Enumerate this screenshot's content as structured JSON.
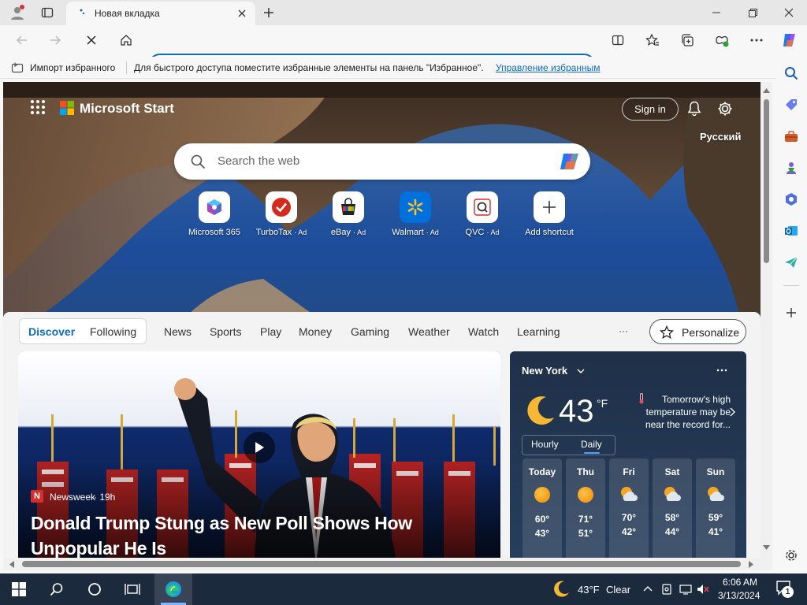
{
  "browser": {
    "tab_title": "Новая вкладка",
    "address_value": "",
    "favorites_bar": {
      "import_label": "Импорт избранного",
      "hint_text": "Для быстрого доступа поместите избранные элементы на панель \"Избранное\".",
      "manage_link": "Управление избранным"
    }
  },
  "start_page": {
    "brand": "Microsoft Start",
    "sign_in_label": "Sign in",
    "language": "Русский",
    "search_placeholder": "Search the web",
    "shortcuts": [
      {
        "label": "Microsoft 365",
        "ad": "",
        "icon": "microsoft-365-icon"
      },
      {
        "label": "TurboTax",
        "ad": "· Ad",
        "icon": "turbotax-icon"
      },
      {
        "label": "eBay",
        "ad": "· Ad",
        "icon": "ebay-icon"
      },
      {
        "label": "Walmart",
        "ad": "· Ad",
        "icon": "walmart-icon"
      },
      {
        "label": "QVC",
        "ad": "· Ad",
        "icon": "qvc-icon"
      },
      {
        "label": "Add shortcut",
        "ad": "",
        "icon": "plus-icon"
      }
    ],
    "nav_tabs": [
      "Discover",
      "Following",
      "News",
      "Sports",
      "Play",
      "Money",
      "Gaming",
      "Weather",
      "Watch",
      "Learning"
    ],
    "nav_more": "···",
    "personalize_label": "Personalize",
    "story": {
      "source": "Newsweek",
      "age": "· 19h",
      "headline_line1": "Donald Trump Stung as New Poll Shows How",
      "headline_line2": "Unpopular He Is"
    },
    "weather": {
      "city": "New York",
      "temp": "43",
      "unit": "°F",
      "alert_line1": "Tomorrow's high",
      "alert_line2": "temperature may be",
      "alert_line3": "near the record for...",
      "toggle": [
        "Hourly",
        "Daily"
      ],
      "days": [
        {
          "name": "Today",
          "high": "60°",
          "low": "43°",
          "icon": "sunny-icon"
        },
        {
          "name": "Thu",
          "high": "71°",
          "low": "51°",
          "icon": "sunny-icon"
        },
        {
          "name": "Fri",
          "high": "70°",
          "low": "42°",
          "icon": "partly-cloudy-icon"
        },
        {
          "name": "Sat",
          "high": "58°",
          "low": "44°",
          "icon": "partly-cloudy-icon"
        },
        {
          "name": "Sun",
          "high": "59°",
          "low": "41°",
          "icon": "partly-cloudy-icon"
        }
      ]
    }
  },
  "taskbar": {
    "weather_temp": "43°F",
    "weather_cond": "Clear",
    "time": "6:06 AM",
    "date": "3/13/2024",
    "notification_count": "1"
  }
}
